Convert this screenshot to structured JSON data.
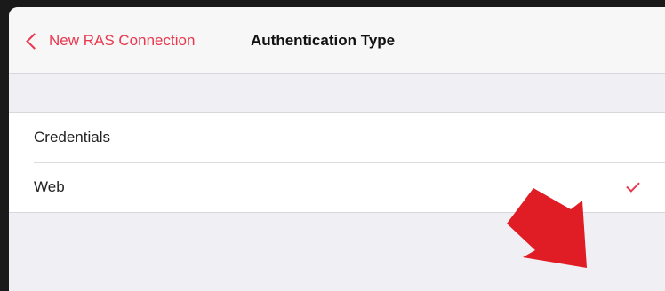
{
  "nav": {
    "back_label": "New RAS Connection",
    "title": "Authentication Type"
  },
  "options": [
    {
      "label": "Credentials",
      "selected": false
    },
    {
      "label": "Web",
      "selected": true
    }
  ],
  "colors": {
    "accent": "#e8384f",
    "annotation_arrow": "#e01d24"
  }
}
